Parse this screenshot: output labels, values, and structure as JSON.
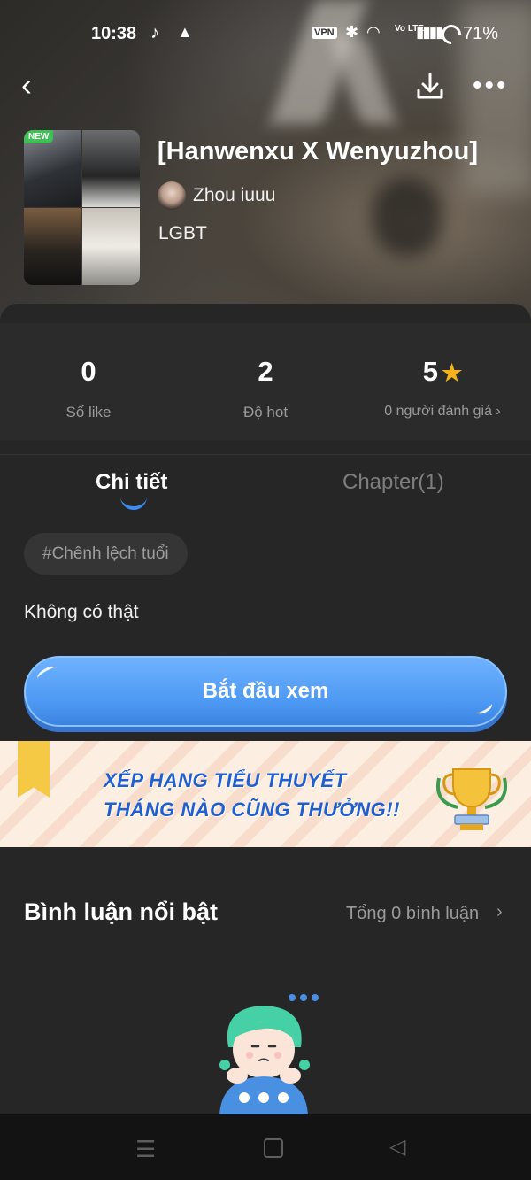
{
  "status_bar": {
    "time": "10:38",
    "vpn": "VPN",
    "volte": "Vo LTE",
    "battery": "71%"
  },
  "header": {
    "title": "[Hanwenxu X Wenyuzhou]",
    "author": "Zhou iuuu",
    "genre": "LGBT",
    "cover_badge": "NEW"
  },
  "stats": {
    "likes_value": "0",
    "likes_label": "Số like",
    "hot_value": "2",
    "hot_label": "Độ hot",
    "rating_value": "5",
    "rating_label": "0 người đánh giá",
    "rating_star_color": "#f6b21b"
  },
  "tabs": {
    "details": "Chi tiết",
    "chapters": "Chapter(1)"
  },
  "details": {
    "tag": "#Chênh lệch tuổi",
    "description": "Không có thật"
  },
  "start_button": {
    "label": "Bắt đầu xem",
    "color": "#4b97f2"
  },
  "banner": {
    "line1": "XẾP HẠNG TIỂU THUYẾT",
    "line2": "THÁNG NÀO CŨNG THƯỞNG!!"
  },
  "comments": {
    "title": "Bình luận nổi bật",
    "total": "Tổng 0 bình luận"
  }
}
